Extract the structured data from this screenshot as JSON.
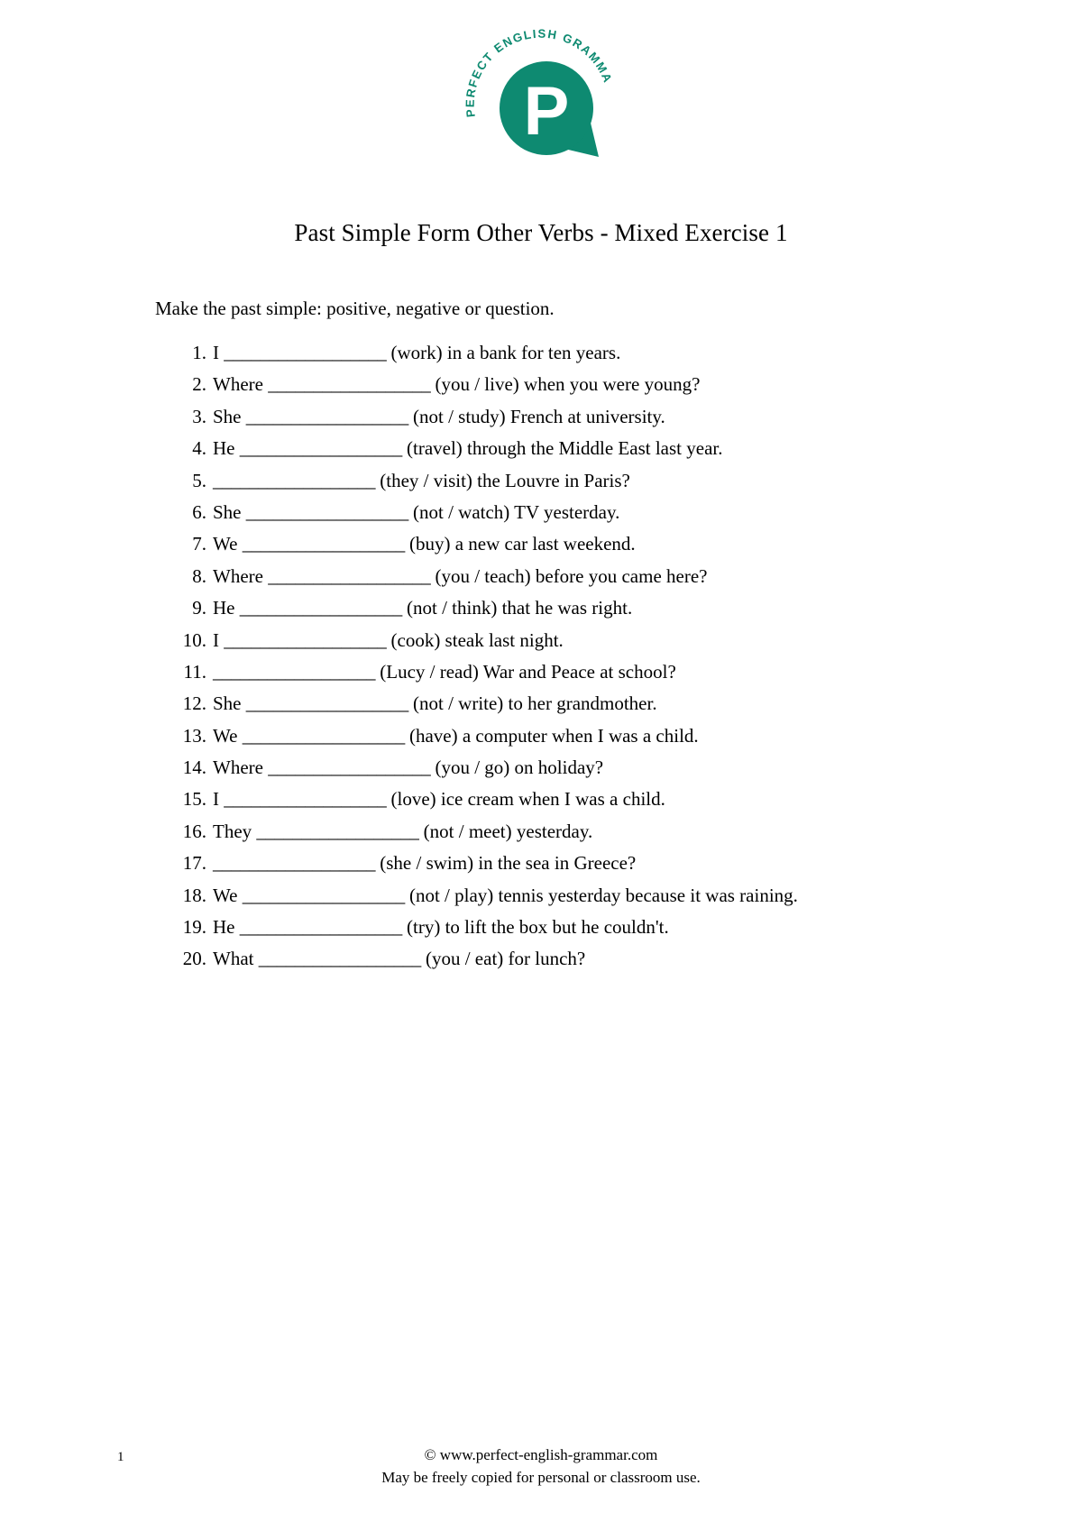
{
  "logo": {
    "brand_text": "PERFECT ENGLISH GRAMMAR",
    "monogram": "P",
    "color": "#0e8a71"
  },
  "title": "Past Simple Form Other Verbs - Mixed Exercise 1",
  "instruction": "Make the past simple: positive, negative or question.",
  "blank": "__________________",
  "questions": [
    {
      "number": "1.",
      "before": "I ",
      "after": " (work) in a bank for ten years."
    },
    {
      "number": "2.",
      "before": "Where ",
      "after": " (you / live) when you were young?"
    },
    {
      "number": "3.",
      "before": "She ",
      "after": " (not / study) French at university."
    },
    {
      "number": "4.",
      "before": "He ",
      "after": " (travel) through the Middle East last year."
    },
    {
      "number": "5.",
      "before": "",
      "after": " (they / visit) the Louvre in Paris?"
    },
    {
      "number": "6.",
      "before": "She ",
      "after": " (not / watch) TV yesterday."
    },
    {
      "number": "7.",
      "before": "We ",
      "after": " (buy) a new car last weekend."
    },
    {
      "number": "8.",
      "before": "Where ",
      "after": " (you / teach) before you came here?"
    },
    {
      "number": "9.",
      "before": "He ",
      "after": " (not / think) that he was right."
    },
    {
      "number": "10.",
      "before": "I ",
      "after": " (cook) steak last night."
    },
    {
      "number": "11.",
      "before": "",
      "after": " (Lucy / read) War and Peace at school?"
    },
    {
      "number": "12.",
      "before": "She ",
      "after": " (not / write) to her grandmother."
    },
    {
      "number": "13.",
      "before": "We ",
      "after": " (have) a computer when I was a child."
    },
    {
      "number": "14.",
      "before": "Where ",
      "after": " (you / go) on holiday?"
    },
    {
      "number": "15.",
      "before": "I ",
      "after": " (love) ice cream when I was a child."
    },
    {
      "number": "16.",
      "before": "They ",
      "after": " (not / meet) yesterday."
    },
    {
      "number": "17.",
      "before": "",
      "after": " (she / swim) in the sea in Greece?"
    },
    {
      "number": "18.",
      "before": "We ",
      "after": " (not / play) tennis yesterday because it was raining."
    },
    {
      "number": "19.",
      "before": "He ",
      "after": " (try) to lift the box but he couldn't."
    },
    {
      "number": "20.",
      "before": "What ",
      "after": " (you / eat) for lunch?"
    }
  ],
  "footer": {
    "page_number": "1",
    "copyright": "© www.perfect-english-grammar.com",
    "permission": "May be freely copied for personal or classroom use."
  }
}
